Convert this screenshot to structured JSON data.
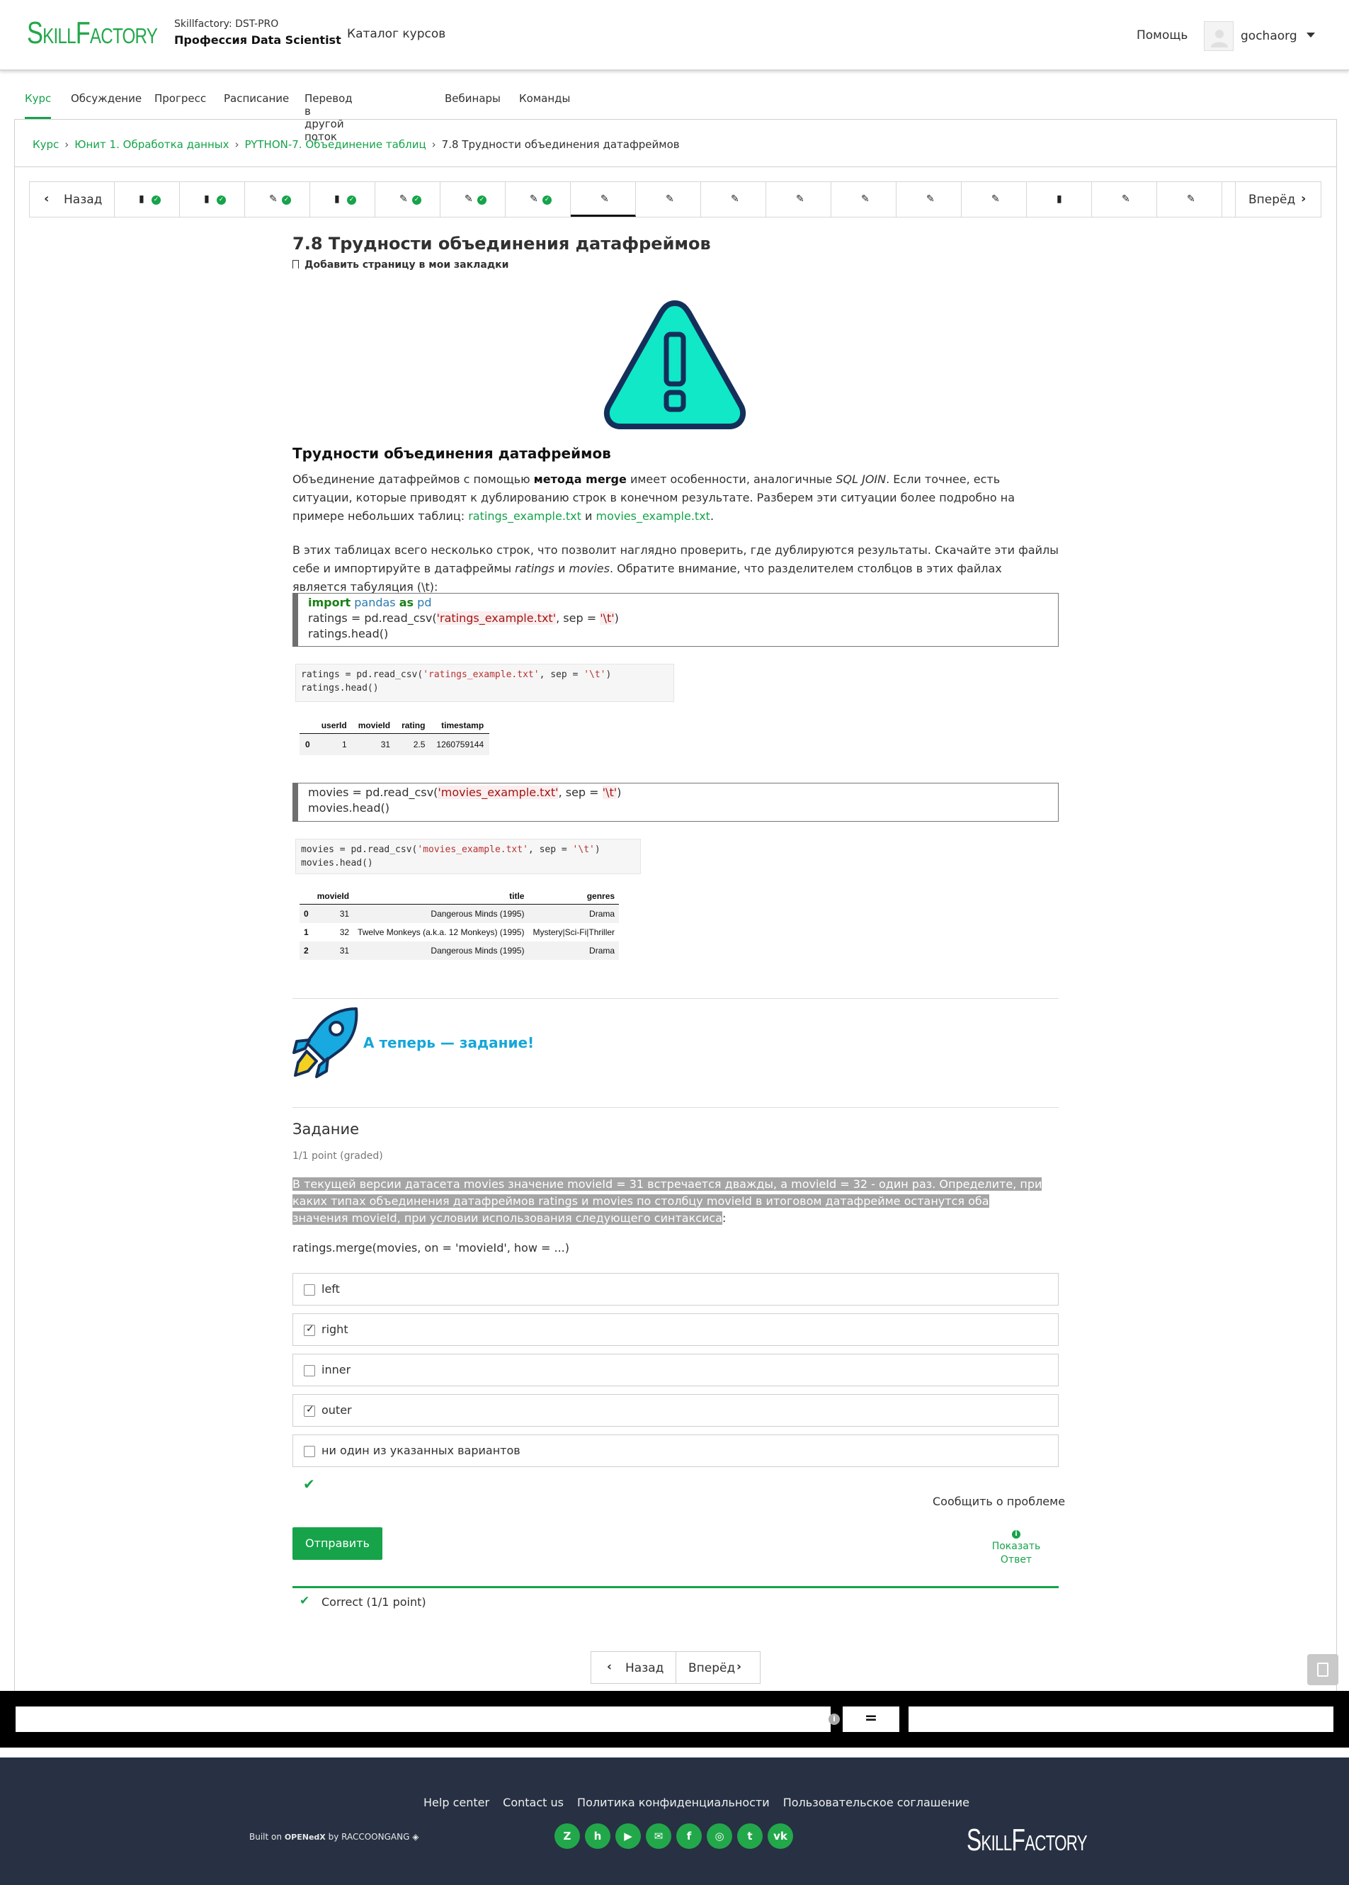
{
  "header": {
    "logo": "SkillFactory",
    "course_org": "Skillfactory: DST-PRO",
    "course_name": "Профессия Data Scientist",
    "catalog": "Каталог курсов",
    "help": "Помощь",
    "username": "gochaorg"
  },
  "tabs": [
    "Курс",
    "Обсуждение",
    "Прогресс",
    "Расписание",
    "Перевод в другой поток",
    "Вебинары",
    "Команды"
  ],
  "breadcrumb": {
    "items": [
      "Курс",
      "Юнит 1. Обработка данных",
      "PYTHON-7. Объединение таблиц"
    ],
    "current": "7.8 Трудности объединения датафреймов"
  },
  "seqnav": {
    "prev": "Назад",
    "next": "Вперёд",
    "items": [
      {
        "icon": "book-icon",
        "done": true
      },
      {
        "icon": "book-icon",
        "done": true
      },
      {
        "icon": "edit-icon",
        "done": true
      },
      {
        "icon": "book-icon",
        "done": true
      },
      {
        "icon": "edit-icon",
        "done": true
      },
      {
        "icon": "edit-icon",
        "done": true
      },
      {
        "icon": "edit-icon",
        "done": true
      },
      {
        "icon": "edit-icon",
        "done": false,
        "active": true
      },
      {
        "icon": "edit-icon",
        "done": false
      },
      {
        "icon": "edit-icon",
        "done": false
      },
      {
        "icon": "edit-icon",
        "done": false
      },
      {
        "icon": "edit-icon",
        "done": false
      },
      {
        "icon": "edit-icon",
        "done": false
      },
      {
        "icon": "edit-icon",
        "done": false
      },
      {
        "icon": "book-icon",
        "done": false
      },
      {
        "icon": "edit-icon",
        "done": false
      },
      {
        "icon": "edit-icon",
        "done": false
      }
    ]
  },
  "unit": {
    "title": "7.8 Трудности объединения датафреймов",
    "bookmark": "Добавить страницу в мои закладки",
    "heading": "Трудности объединения датафреймов",
    "p1_a": "Объединение датафреймов с помощью ",
    "p1_b": "метода merge",
    "p1_c": " имеет особенности, аналогичные ",
    "p1_d": "SQL JOIN",
    "p1_e": ". Если точнее, есть ситуации, которые приводят к дублированию строк в конечном результате. Разберем эти ситуации более подробно на примере небольших таблиц: ",
    "link1": "ratings_example.txt",
    "p1_f": " и ",
    "link2": "movies_example.txt",
    "p1_g": ".",
    "p2_a": "В этих таблицах всего несколько строк, что позволит наглядно проверить, где дублируются результаты. Скачайте эти файлы себе и импортируйте в датафреймы ",
    "p2_b": "ratings",
    "p2_c": " и ",
    "p2_d": "movies",
    "p2_e": ". Обратите внимание, что разделителем столбцов в этих файлах является табуляция (\\t):"
  },
  "code1": {
    "l1_kw1": "import",
    "l1_mod": "pandas",
    "l1_kw2": "as",
    "l1_alias": "pd",
    "l2_a": "ratings = pd.read_csv(",
    "l2_str1": "'ratings_example.txt'",
    "l2_b": ", sep = ",
    "l2_str2": "'\\t'",
    "l2_c": ")",
    "l3": "ratings.head()"
  },
  "nb1": {
    "a": "ratings = pd.read_csv(",
    "s1": "'ratings_example.txt'",
    "b": ", sep = ",
    "s2": "'\\t'",
    "c": ")",
    "l2": "ratings.head()"
  },
  "table1": {
    "columns": [
      "",
      "userId",
      "movieId",
      "rating",
      "timestamp"
    ],
    "rows": [
      [
        "0",
        "1",
        "31",
        "2.5",
        "1260759144"
      ]
    ]
  },
  "code2": {
    "l1_a": "movies = pd.read_csv(",
    "l1_str1": "'movies_example.txt'",
    "l1_b": ", sep = ",
    "l1_str2": "'\\t'",
    "l1_c": ")",
    "l2": "movies.head()"
  },
  "nb2": {
    "a": "movies = pd.read_csv(",
    "s1": "'movies_example.txt'",
    "b": ", sep = ",
    "s2": "'\\t'",
    "c": ")",
    "l2": "movies.head()"
  },
  "table2": {
    "columns": [
      "",
      "movieId",
      "title",
      "genres"
    ],
    "rows": [
      [
        "0",
        "31",
        "Dangerous Minds (1995)",
        "Drama"
      ],
      [
        "1",
        "32",
        "Twelve Monkeys (a.k.a. 12 Monkeys) (1995)",
        "Mystery|Sci-Fi|Thriller"
      ],
      [
        "2",
        "31",
        "Dangerous Minds (1995)",
        "Drama"
      ]
    ]
  },
  "callout": "А теперь — задание!",
  "problem": {
    "title": "Задание",
    "points": "1/1 point (graded)",
    "text": "В текущей версии датасета movies значение movieId = 31 встречается дважды, а movieId = 32 - один раз. Определите, при каких типах объединения датафреймов ratings и movies по столбцу movieId в итоговом датафрейме останутся оба значения movieId, при условии использования следующего синтаксиса",
    "text_tail": ":",
    "merge_line": "ratings.merge(movies, on = 'movieId', how = ...)",
    "choices": [
      {
        "label": "left",
        "checked": false
      },
      {
        "label": "right",
        "checked": true
      },
      {
        "label": "inner",
        "checked": false
      },
      {
        "label": "outer",
        "checked": true
      },
      {
        "label": "ни один из указанных вариантов",
        "checked": false
      }
    ],
    "report": "Сообщить о проблеме",
    "submit": "Отправить",
    "show_answer_1": "Показать",
    "show_answer_2": "Ответ",
    "result": "Correct (1/1 point)"
  },
  "bottom_nav": {
    "prev": "Назад",
    "next": "Вперёд"
  },
  "calculator": {
    "equals": "="
  },
  "footer": {
    "links": [
      "Help center",
      "Contact us",
      "Политика конфиденциальности",
      "Пользовательское соглашение"
    ],
    "built_on": "Built on",
    "openedx": "OPENedX",
    "by": "by RACCOONGANG",
    "logo": "SkillFactory",
    "socials": [
      "zen-icon",
      "habr-icon",
      "youtube-icon",
      "chat-icon",
      "facebook-icon",
      "instagram-icon",
      "twitter-icon",
      "vk-icon"
    ]
  },
  "colors": {
    "accent": "#16a34a",
    "callout": "#16a6d9",
    "footer_bg": "#273143",
    "warning_fill": "#10e0c0"
  }
}
